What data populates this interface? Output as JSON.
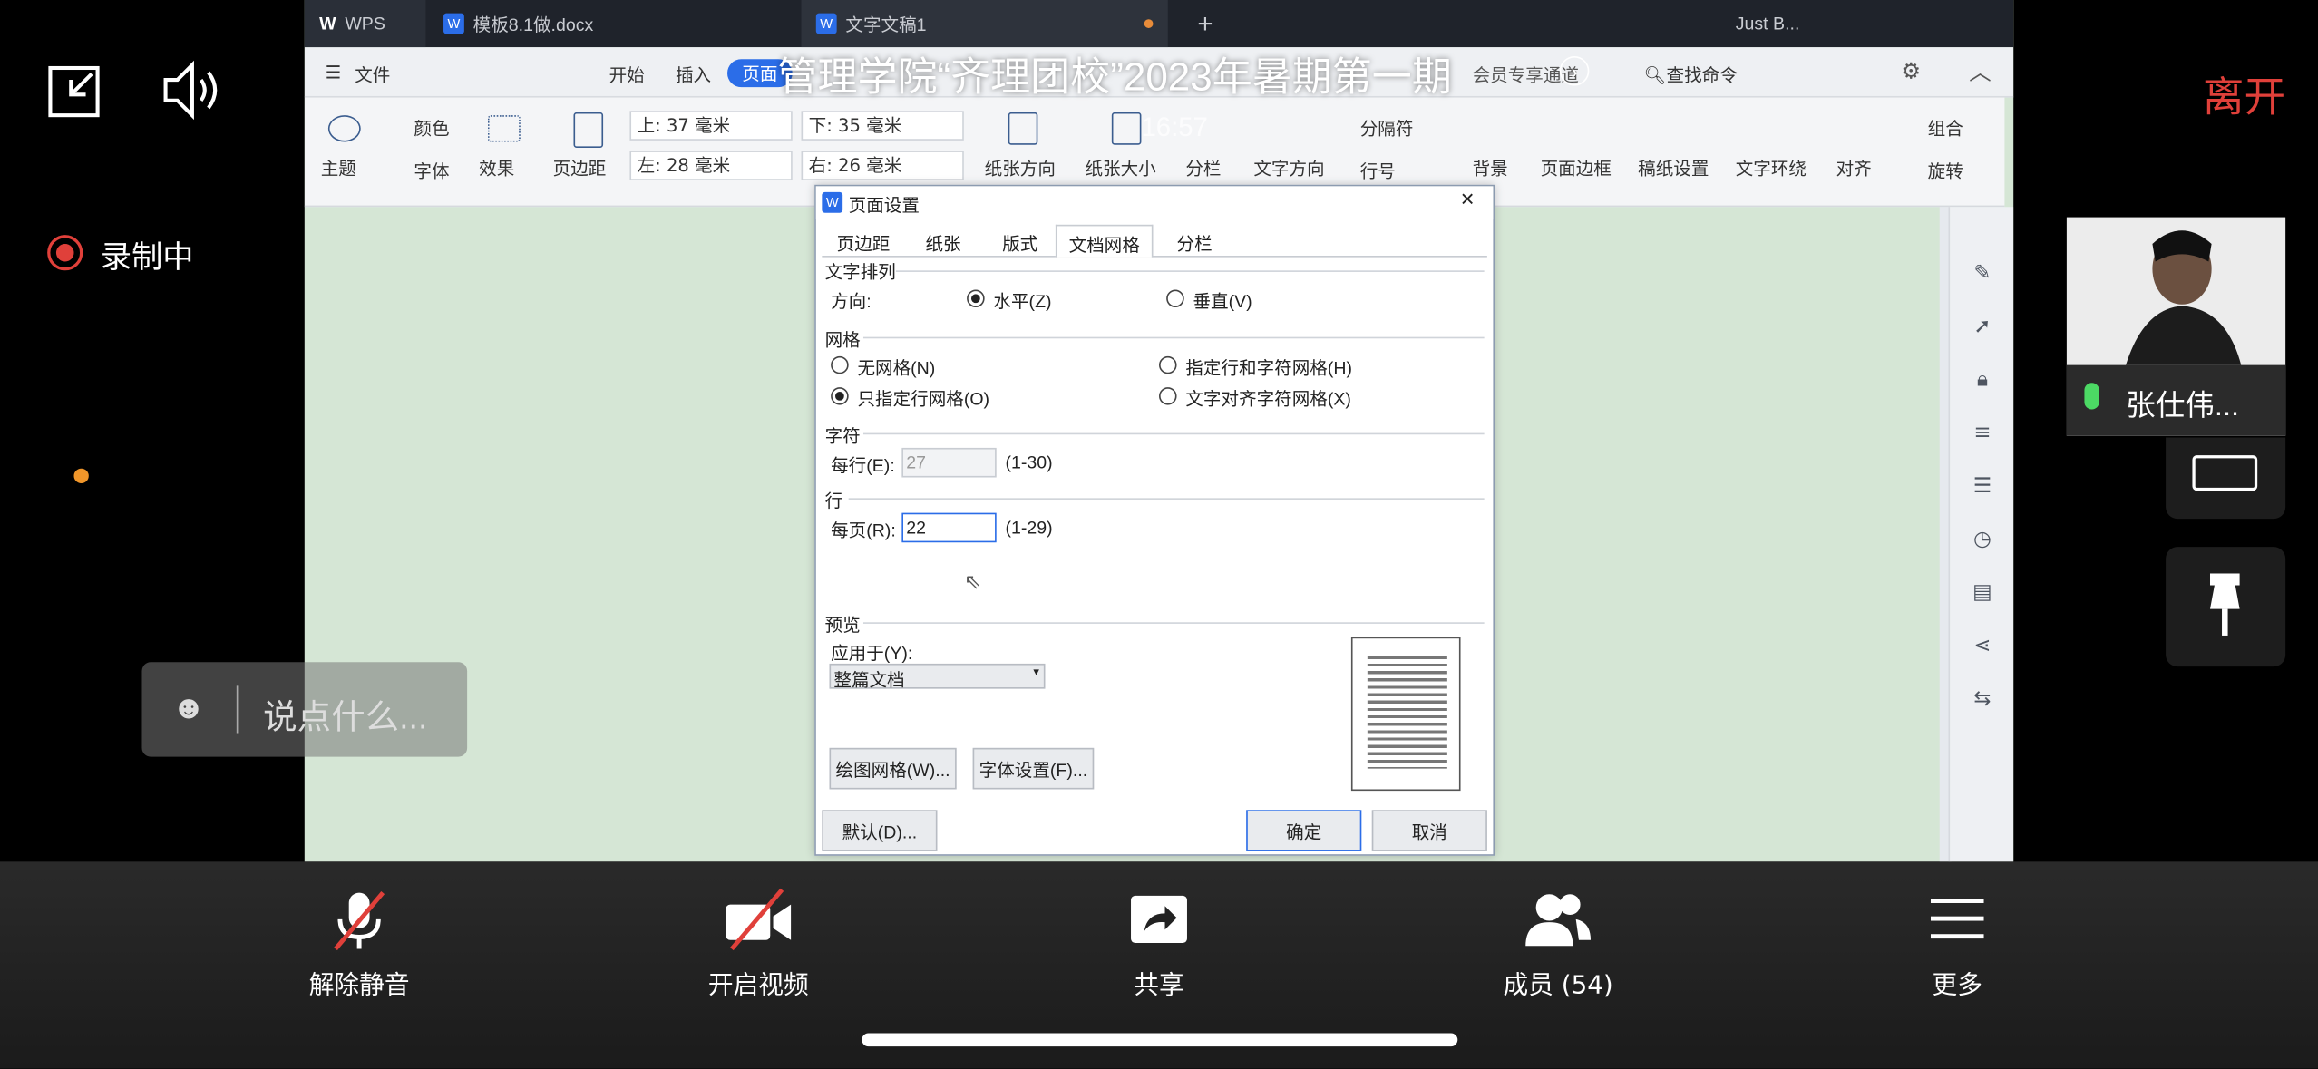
{
  "overlay": {
    "meeting_title": "管理学院“齐理团校”2023年暑期第一期",
    "clock": "16:57",
    "leave_label": "离开",
    "recording_label": "录制中",
    "chat_placeholder": "说点什么...",
    "participant_name": "张仕伟..."
  },
  "bottom_bar": {
    "unmute": "解除静音",
    "start_video": "开启视频",
    "share": "共享",
    "members": "成员 (54)",
    "more": "更多"
  },
  "app_tabs": {
    "wps": "WPS",
    "doc1": "模板8.1做.docx",
    "doc2": "文字文稿1",
    "user": "Just B..."
  },
  "menu": {
    "file": "文件",
    "start": "开始",
    "insert": "插入",
    "page": "页面",
    "find": "查找命令",
    "more_tab": "会员专享通道"
  },
  "ribbon": {
    "theme": "主题",
    "color": "颜色",
    "font": "字体",
    "effect": "效果",
    "margin": "页边距",
    "top": "上: 37 毫米",
    "bottom": "下: 35 毫米",
    "left": "左: 28 毫米",
    "right": "右: 26 毫米",
    "orientation": "纸张方向",
    "size": "纸张大小",
    "columns": "分栏",
    "text_dir": "文字方向",
    "separator": "分隔符",
    "line_no": "行号",
    "background": "背景",
    "border": "页面边框",
    "draft": "稿纸设置",
    "wrap": "文字环绕",
    "align": "对齐",
    "group": "组合",
    "rotate": "旋转"
  },
  "dialog": {
    "title": "页面设置",
    "close": "×",
    "tabs": [
      "页边距",
      "纸张",
      "版式",
      "文档网格",
      "分栏"
    ],
    "active_tab": "文档网格",
    "sec_text": "文字排列",
    "direction": "方向:",
    "horizontal": "水平(Z)",
    "vertical": "垂直(V)",
    "sec_grid": "网格",
    "no_grid": "无网格(N)",
    "line_char_grid": "指定行和字符网格(H)",
    "line_grid": "只指定行网格(O)",
    "align_char_grid": "文字对齐字符网格(X)",
    "sec_char": "字符",
    "per_line": "每行(E):",
    "per_line_value": "27",
    "per_line_range": "(1-30)",
    "sec_row": "行",
    "per_page": "每页(R):",
    "per_page_value": "22",
    "per_page_range": "(1-29)",
    "sec_preview": "预览",
    "apply_to": "应用于(Y):",
    "apply_value": "整篇文档",
    "draw_grid": "绘图网格(W)...",
    "font_settings": "字体设置(F)...",
    "default": "默认(D)...",
    "ok": "确定",
    "cancel": "取消"
  },
  "colors": {
    "accent_red": "#e0403a",
    "doc_bg": "#d5e6d5",
    "dialog_focus": "#2b6de8"
  }
}
